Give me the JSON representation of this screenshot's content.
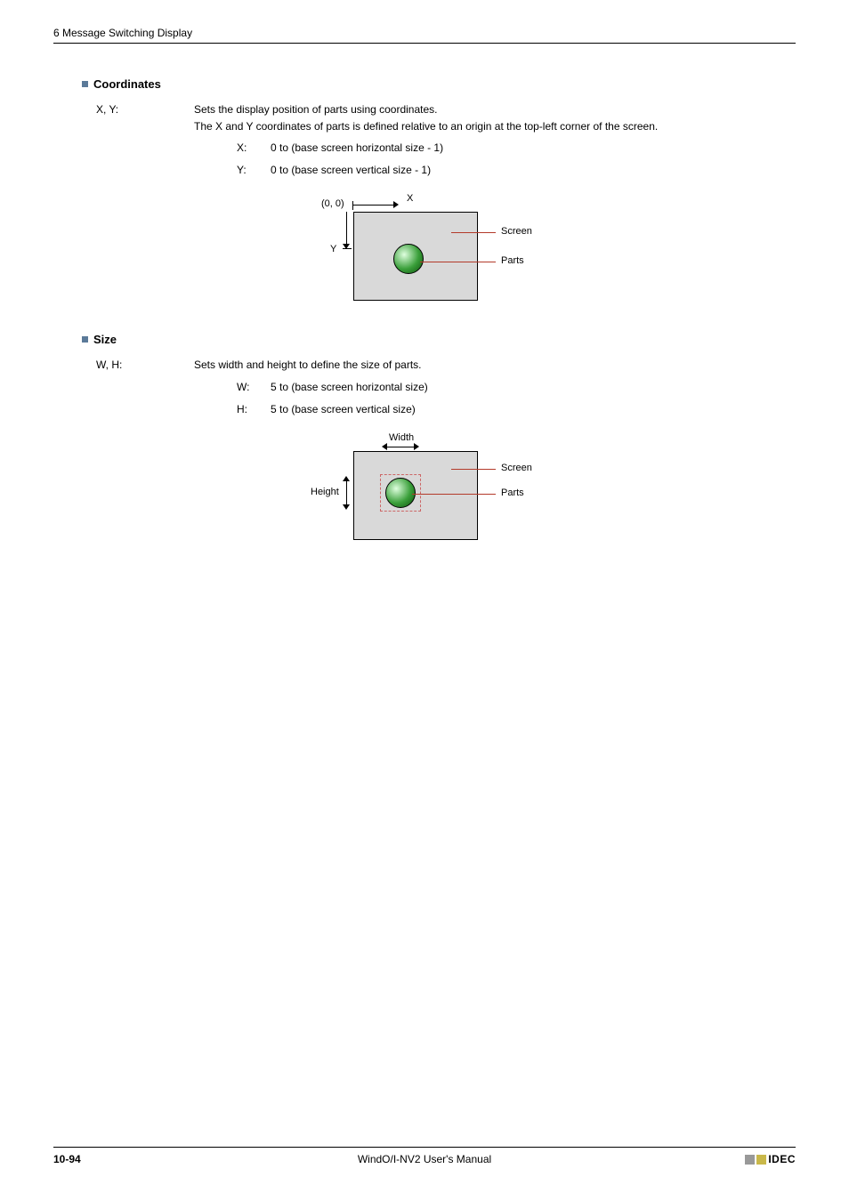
{
  "header": {
    "title": "6 Message Switching Display"
  },
  "sections": {
    "coordinates": {
      "title": "Coordinates",
      "termLabel": "X, Y:",
      "line1": "Sets the display position of parts using coordinates.",
      "line2": "The X and Y coordinates of parts is defined relative to an origin at the top-left corner of the screen.",
      "sub": {
        "x": {
          "label": "X:",
          "text": "0 to (base screen horizontal size - 1)"
        },
        "y": {
          "label": "Y:",
          "text": "0 to (base screen vertical size - 1)"
        }
      },
      "diagram": {
        "origin": "(0, 0)",
        "xAxis": "X",
        "yAxis": "Y",
        "screen": "Screen",
        "parts": "Parts"
      }
    },
    "size": {
      "title": "Size",
      "termLabel": "W, H:",
      "line1": "Sets width and height to define the size of parts.",
      "sub": {
        "w": {
          "label": "W:",
          "text": "5 to (base screen horizontal size)"
        },
        "h": {
          "label": "H:",
          "text": "5 to (base screen vertical size)"
        }
      },
      "diagram": {
        "width": "Width",
        "height": "Height",
        "screen": "Screen",
        "parts": "Parts"
      }
    }
  },
  "footer": {
    "page": "10-94",
    "manual": "WindO/I-NV2 User's Manual",
    "brand": "IDEC"
  }
}
